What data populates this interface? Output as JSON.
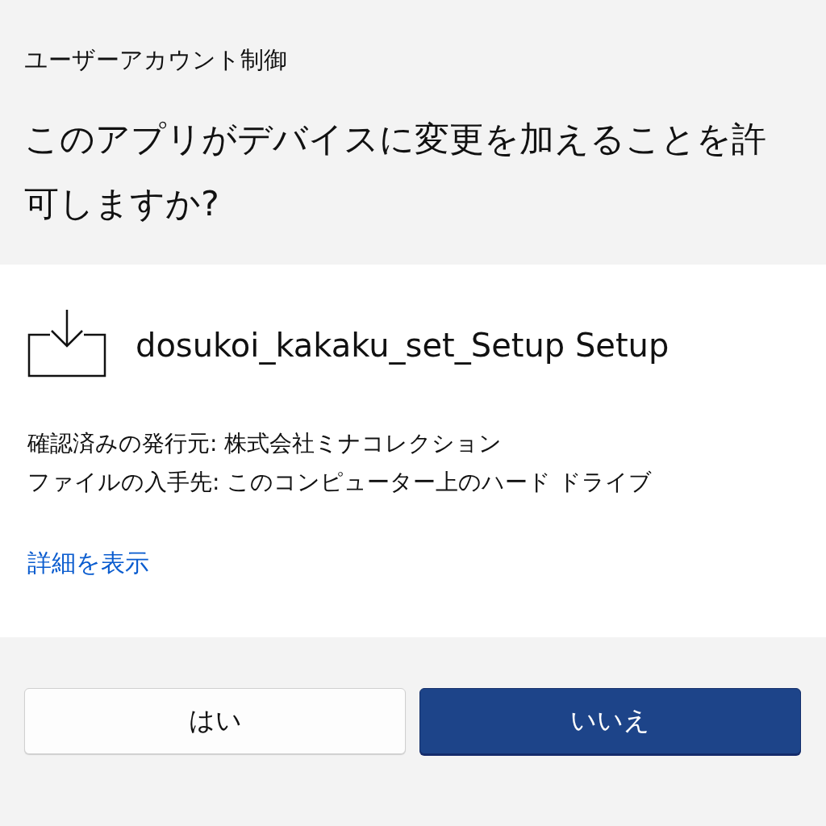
{
  "window": {
    "title": "ユーザーアカウント制御"
  },
  "prompt": "このアプリがデバイスに変更を加えることを許可しますか?",
  "app": {
    "name": "dosukoi_kakaku_set_Setup Setup"
  },
  "details": [
    "確認済みの発行元: 株式会社ミナコレクション",
    "ファイルの入手先: このコンピューター上のハード ドライブ"
  ],
  "link": "詳細を表示",
  "buttons": [
    {
      "label": "はい",
      "kind": "secondary"
    },
    {
      "label": "いいえ",
      "kind": "primary"
    }
  ]
}
